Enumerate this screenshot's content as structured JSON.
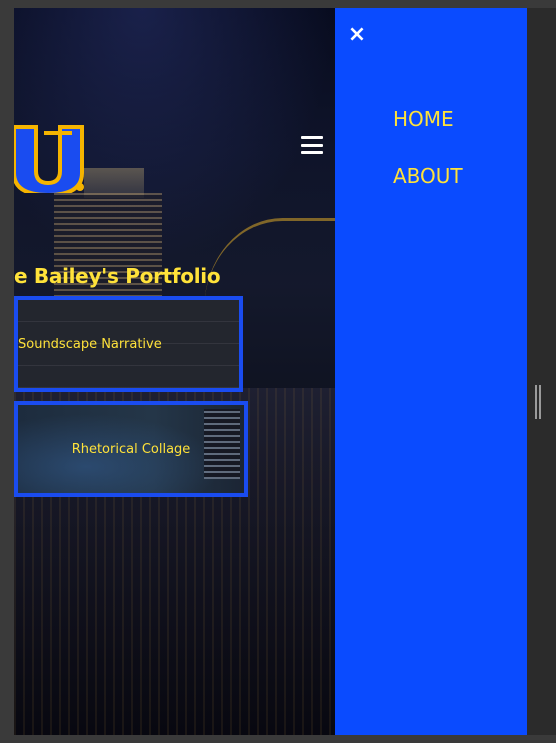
{
  "page": {
    "title": "e Bailey's Portfolio"
  },
  "nav": {
    "close_icon": "×",
    "items": [
      {
        "label": "HOME"
      },
      {
        "label": "ABOUT"
      }
    ]
  },
  "projects": [
    {
      "label": "Soundscape Narrative"
    },
    {
      "label": "Rhetorical Collage"
    }
  ],
  "colors": {
    "accent_yellow": "#ffe23a",
    "menu_blue": "#0a4bff",
    "card_border": "#1a4cf0"
  },
  "icons": {
    "menu": "hamburger-icon",
    "close": "close-icon",
    "logo": "logo-icon"
  }
}
